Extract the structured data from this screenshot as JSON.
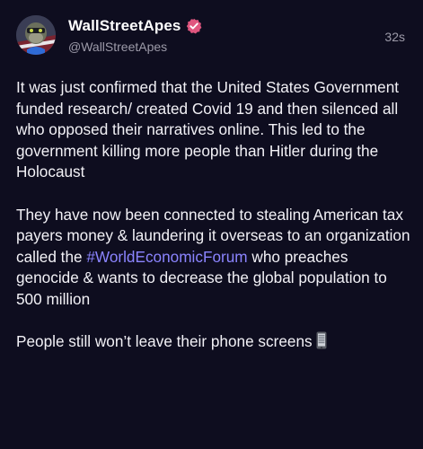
{
  "post": {
    "display_name": "WallStreetApes",
    "handle": "@WallStreetApes",
    "timestamp": "32s",
    "paragraph1": "It was just confirmed that the United States Government funded research/ created Covid 19 and then silenced all who opposed their narratives online. This led to the government killing more people than Hitler during the Holocaust",
    "paragraph2_before": "They have now been connected to stealing American tax payers money & laundering it overseas to an organization called the ",
    "hashtag": "#WorldEconomicForum",
    "paragraph2_after": " who preaches genocide & wants to decrease the global population to 500 million",
    "paragraph3": "People still won’t leave their phone screens"
  },
  "colors": {
    "background": "#0e0d1f",
    "text": "#f2f1f6",
    "muted": "#9c9aa8",
    "hashtag": "#8b84ff",
    "verified_badge": "#e0567f"
  },
  "icons": {
    "avatar": "ape-avatar",
    "verified": "verified-badge-icon",
    "emoji": "mobile-phone-icon"
  }
}
